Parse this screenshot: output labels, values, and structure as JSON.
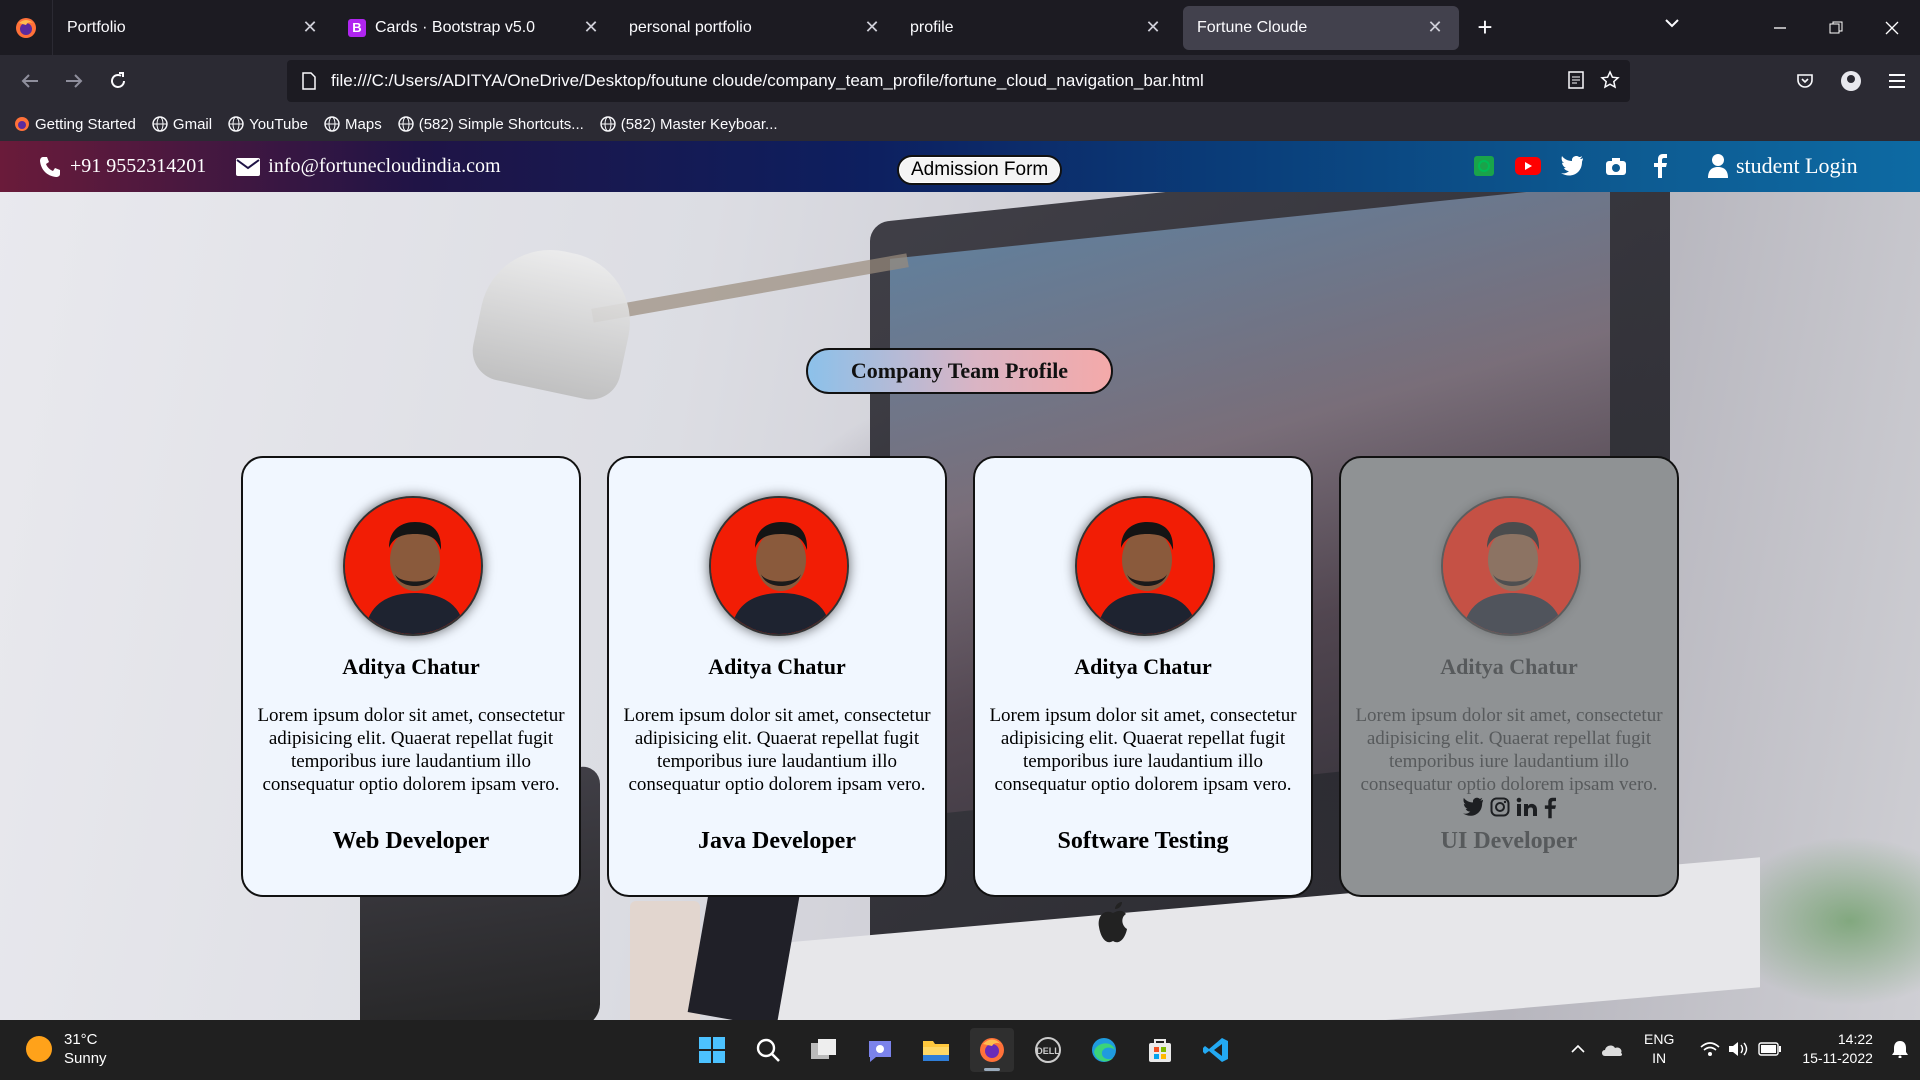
{
  "browser": {
    "tabs": [
      {
        "title": "Portfolio",
        "active": false
      },
      {
        "title": "Cards · Bootstrap v5.0",
        "active": false,
        "favicon": "B"
      },
      {
        "title": "personal portfolio",
        "active": false
      },
      {
        "title": "profile",
        "active": false
      },
      {
        "title": "Fortune Cloude",
        "active": true
      }
    ],
    "url": "file:///C:/Users/ADITYA/OneDrive/Desktop/foutune cloude/company_team_profile/fortune_cloud_navigation_bar.html",
    "bookmarks": [
      {
        "label": "Getting Started",
        "icon": "firefox-icon"
      },
      {
        "label": "Gmail",
        "icon": "globe-icon"
      },
      {
        "label": "YouTube",
        "icon": "globe-icon"
      },
      {
        "label": "Maps",
        "icon": "globe-icon"
      },
      {
        "label": "(582) Simple Shortcuts...",
        "icon": "globe-icon"
      },
      {
        "label": "(582) Master Keyboar...",
        "icon": "globe-icon"
      }
    ]
  },
  "site_header": {
    "phone": "+91 9552314201",
    "email": "info@fortunecloudindia.com",
    "admission_label": "Admission Form",
    "login_label": "student Login",
    "social": [
      "whatsapp-icon",
      "youtube-icon",
      "twitter-icon",
      "camera-icon",
      "facebook-icon"
    ]
  },
  "main": {
    "title": "Company Team Profile",
    "cards": [
      {
        "name": "Aditya Chatur",
        "description": "Lorem ipsum dolor sit amet, consectetur adipisicing elit. Quaerat repellat fugit temporibus iure laudantium illo consequatur optio dolorem ipsam vero.",
        "role": "Web Developer"
      },
      {
        "name": "Aditya Chatur",
        "description": "Lorem ipsum dolor sit amet, consectetur adipisicing elit. Quaerat repellat fugit temporibus iure laudantium illo consequatur optio dolorem ipsam vero.",
        "role": "Java Developer"
      },
      {
        "name": "Aditya Chatur",
        "description": "Lorem ipsum dolor sit amet, consectetur adipisicing elit. Quaerat repellat fugit temporibus iure laudantium illo consequatur optio dolorem ipsam vero.",
        "role": "Software Testing"
      },
      {
        "name": "Aditya Chatur",
        "description": "Lorem ipsum dolor sit amet, consectetur adipisicing elit. Quaerat repellat fugit temporibus iure laudantium illo consequatur optio dolorem ipsam vero.",
        "role": "UI Developer"
      }
    ]
  },
  "taskbar": {
    "weather_temp": "31°C",
    "weather_desc": "Sunny",
    "lang_1": "ENG",
    "lang_2": "IN",
    "time": "14:22",
    "date": "15-11-2022"
  },
  "colors": {
    "header_start": "#6a1b3a",
    "header_end": "#0d6aa3",
    "card_bg": "#f1f7ff",
    "card_hover_bg": "#8f9294",
    "avatar_bg": "#f21d05"
  }
}
